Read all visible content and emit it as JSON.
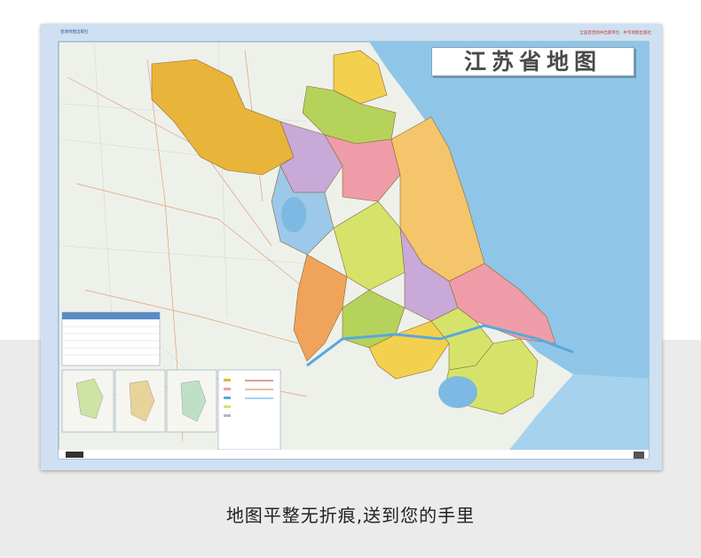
{
  "map": {
    "title": "江苏省地图",
    "publisher_logo_text": "星球地图出版社",
    "header_note": "全国百佳图书出版单位 · 中华地图出版社",
    "inset_captions": [
      "",
      "",
      "",
      ""
    ],
    "colors": {
      "sea": "#8fc6e8",
      "land_bg": "#eef1ea",
      "border_frame": "#9fc3e3",
      "prefecture_palette": [
        "#e9b43a",
        "#f3d04e",
        "#b5d35a",
        "#c8a9d8",
        "#ef9ca8",
        "#f4c56b",
        "#9cc8e9",
        "#d6e36a",
        "#f0a35a"
      ]
    }
  },
  "caption": "地图平整无折痕,送到您的手里"
}
